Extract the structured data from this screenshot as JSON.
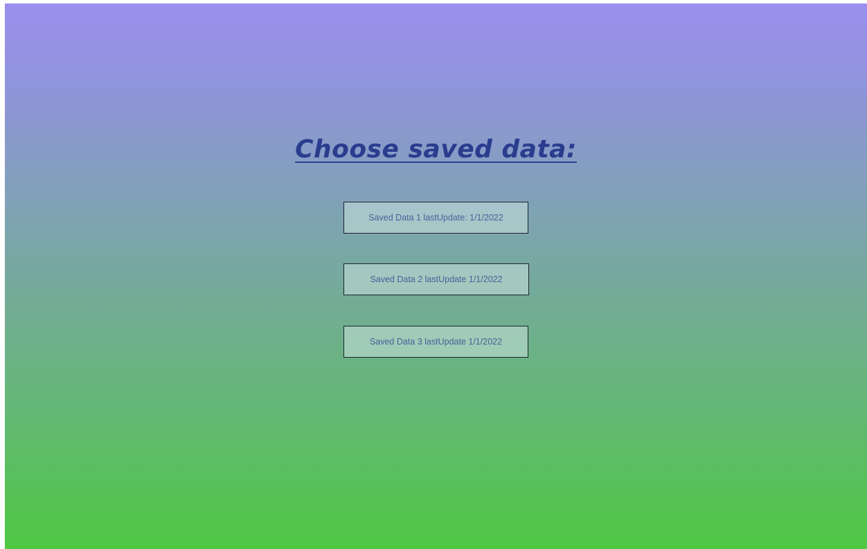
{
  "page": {
    "title": "Choose saved data:"
  },
  "slots": [
    {
      "label": "Saved Data 1 lastUpdate: 1/1/2022"
    },
    {
      "label": "Saved Data 2 lastUpdate 1/1/2022"
    },
    {
      "label": "Saved Data 3 lastUpdate 1/1/2022"
    }
  ],
  "colors": {
    "gradient_top": "#9a8fee",
    "gradient_bottom": "#4fc843",
    "title": "#2a3c8e",
    "slot_text": "#4a5f9a",
    "slot_border": "#1b2230"
  }
}
